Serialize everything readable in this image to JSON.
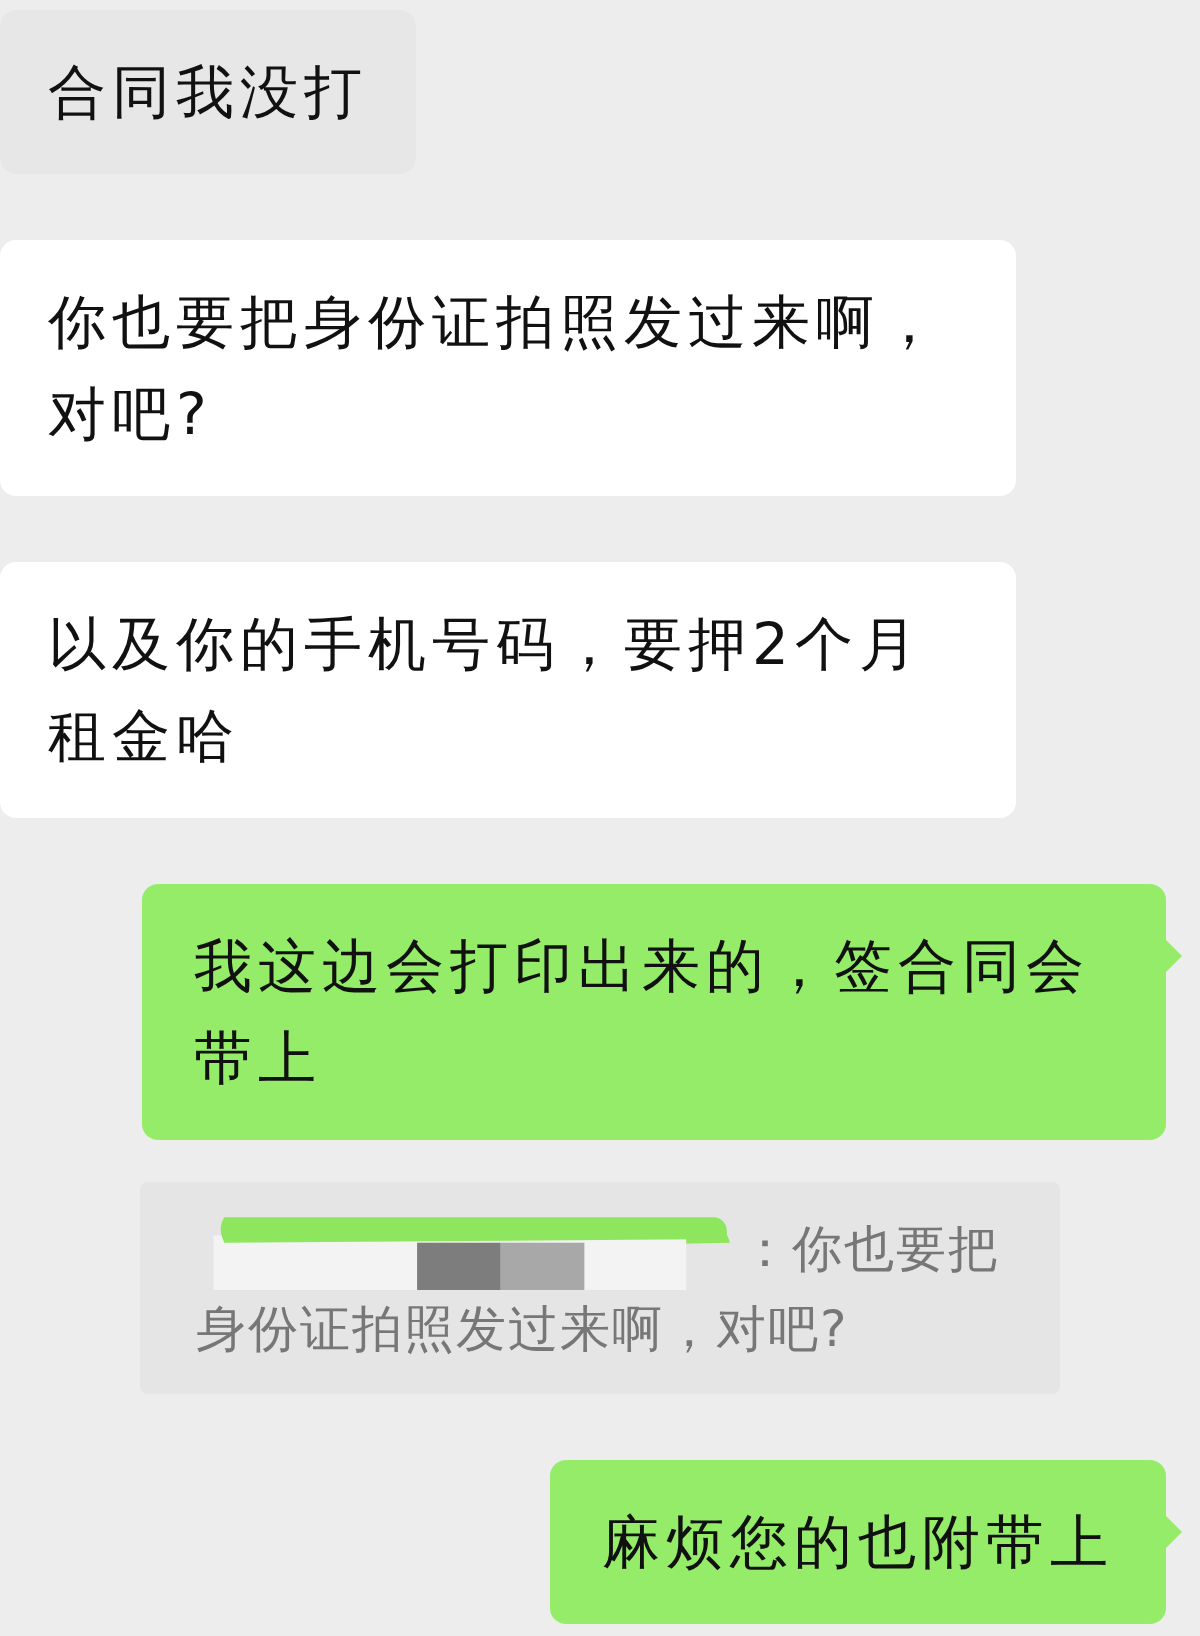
{
  "messages": [
    {
      "kind": "received",
      "text": "合同我没打"
    },
    {
      "kind": "received",
      "text": "你也要把身份证拍照发过来啊，对吧?"
    },
    {
      "kind": "received",
      "text": "以及你的手机号码，要押2个月租金哈"
    },
    {
      "kind": "sent",
      "text": "我这边会打印出来的，签合同会带上"
    },
    {
      "kind": "quote",
      "text": "：你也要把身份证拍照发过来啊，对吧?",
      "redacted": true
    },
    {
      "kind": "sent",
      "text": "麻烦您的也附带上"
    }
  ]
}
